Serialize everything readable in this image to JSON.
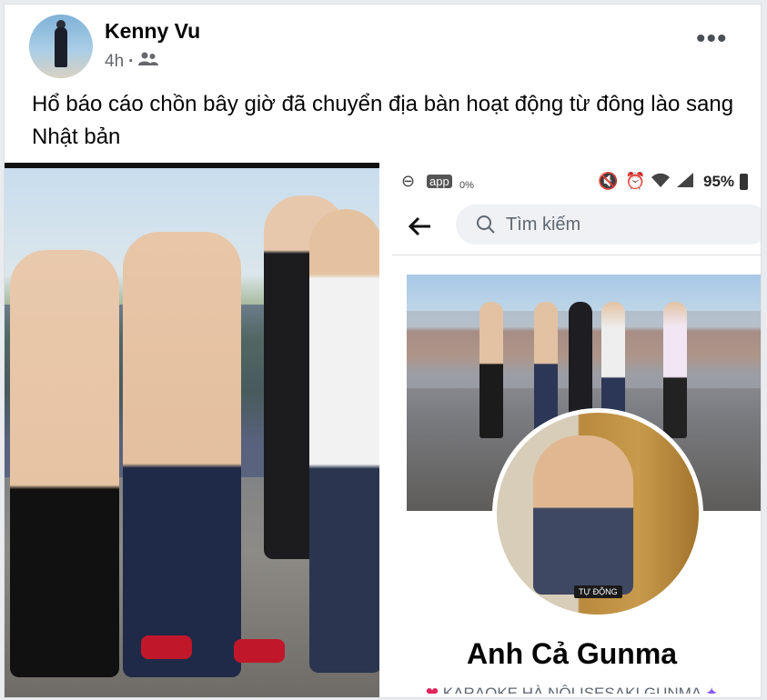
{
  "post": {
    "author": "Kenny Vu",
    "time": "4h",
    "dot": "·",
    "more_label": "•••",
    "caption": "Hổ báo cáo chồn bây giờ đã chuyển địa bàn hoạt động từ đông lào sang Nhật bản"
  },
  "screenshot": {
    "status_bar": {
      "battery_percent": "95%",
      "data_label": "0%"
    },
    "search_placeholder": "Tìm kiếm",
    "profile": {
      "name": "Anh Cả Gunma",
      "bio": "KARAOKE HÀ NỘI ISESAKI GUNMA",
      "photo_tag": "TỰ ĐỘNG"
    }
  },
  "icons": {
    "audience": "friends-icon",
    "back": "back-arrow-icon",
    "search": "search-icon"
  }
}
